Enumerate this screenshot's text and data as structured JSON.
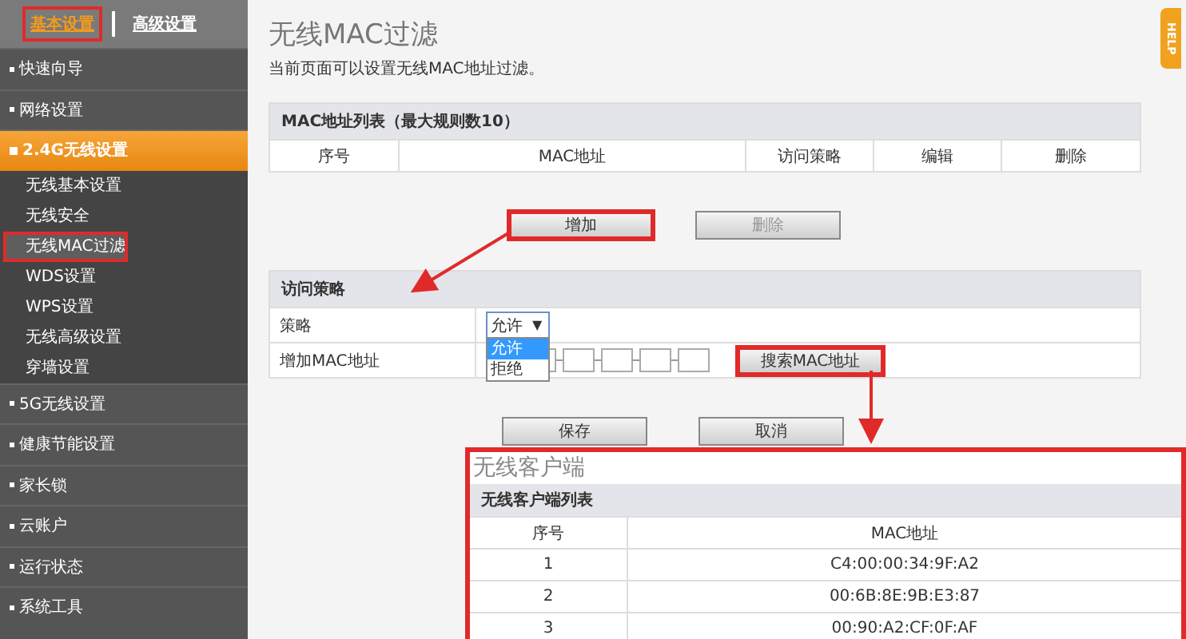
{
  "top_tabs": [
    {
      "label": "基本设置",
      "selected": true,
      "highlighted": true
    },
    {
      "label": "高级设置",
      "selected": false,
      "highlighted": false
    }
  ],
  "sidebar": {
    "items": [
      {
        "label": "快速向导",
        "expanded": false,
        "selected": false
      },
      {
        "label": "网络设置",
        "expanded": false,
        "selected": false
      },
      {
        "label": "2.4G无线设置",
        "expanded": true,
        "selected": true,
        "children": [
          {
            "label": "无线基本设置",
            "selected": false,
            "highlighted": false
          },
          {
            "label": "无线安全",
            "selected": false,
            "highlighted": false
          },
          {
            "label": "无线MAC过滤",
            "selected": true,
            "highlighted": true
          },
          {
            "label": "WDS设置",
            "selected": false,
            "highlighted": false
          },
          {
            "label": "WPS设置",
            "selected": false,
            "highlighted": false
          },
          {
            "label": "无线高级设置",
            "selected": false,
            "highlighted": false
          },
          {
            "label": "穿墙设置",
            "selected": false,
            "highlighted": false
          }
        ]
      },
      {
        "label": "5G无线设置",
        "expanded": false,
        "selected": false
      },
      {
        "label": "健康节能设置",
        "expanded": false,
        "selected": false
      },
      {
        "label": "家长锁",
        "expanded": false,
        "selected": false
      },
      {
        "label": "云账户",
        "expanded": false,
        "selected": false
      },
      {
        "label": "运行状态",
        "expanded": false,
        "selected": false
      },
      {
        "label": "系统工具",
        "expanded": false,
        "selected": false
      }
    ]
  },
  "help_tab": "HELP",
  "page": {
    "title": "无线MAC过滤",
    "description": "当前页面可以设置无线MAC地址过滤。"
  },
  "mac_table": {
    "title": "MAC地址列表（最大规则数10）",
    "columns": [
      "序号",
      "MAC地址",
      "访问策略",
      "编辑",
      "删除"
    ]
  },
  "list_buttons": [
    {
      "label": "增加",
      "disabled": false,
      "highlighted": true
    },
    {
      "label": "删除",
      "disabled": true,
      "highlighted": false
    }
  ],
  "policy_form": {
    "title": "访问策略",
    "policy_label": "策略",
    "policy_value": "允许",
    "dropdown_caret": "▼",
    "options": [
      {
        "label": "允许",
        "selected": true
      },
      {
        "label": "拒绝",
        "selected": false
      }
    ],
    "mac_label": "增加MAC地址",
    "search_button": {
      "label": "搜索MAC地址",
      "highlighted": true
    }
  },
  "form_buttons": [
    {
      "label": "保存",
      "disabled": false
    },
    {
      "label": "取消",
      "disabled": false
    }
  ],
  "client_popup": {
    "title": "无线客户端",
    "list_title": "无线客户端列表",
    "columns": [
      "序号",
      "MAC地址"
    ],
    "rows": [
      [
        "1",
        "C4:00:00:34:9F:A2"
      ],
      [
        "2",
        "00:6B:8E:9B:E3:87"
      ],
      [
        "3",
        "00:90:A2:CF:0F:AF"
      ]
    ]
  }
}
